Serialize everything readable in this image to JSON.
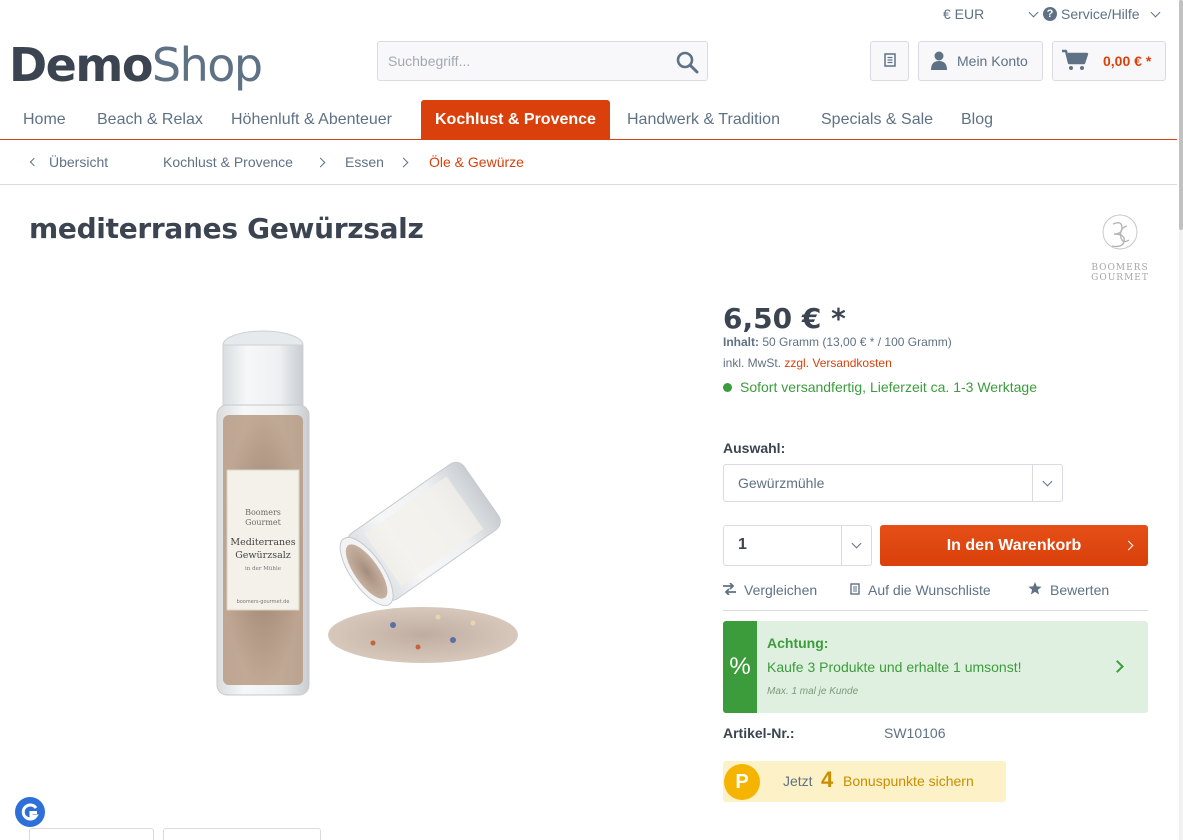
{
  "topbar": {
    "currency": "€ EUR",
    "service": "Service/Hilfe"
  },
  "logo": {
    "bold": "Demo",
    "light": "Shop"
  },
  "search": {
    "placeholder": "Suchbegriff..."
  },
  "header": {
    "account": "Mein Konto",
    "cart_total": "0,00 € *"
  },
  "nav": [
    {
      "label": "Home"
    },
    {
      "label": "Beach & Relax"
    },
    {
      "label": "Höhenluft & Abenteuer"
    },
    {
      "label": "Kochlust & Provence"
    },
    {
      "label": "Handwerk & Tradition"
    },
    {
      "label": "Specials & Sale"
    },
    {
      "label": "Blog"
    }
  ],
  "breadcrumb": {
    "back": "Übersicht",
    "items": [
      "Kochlust & Provence",
      "Essen",
      "Öle & Gewürze"
    ]
  },
  "product": {
    "title": "mediterranes Gewürzsalz",
    "brand_line1": "Boomers",
    "brand_line2": "Gourmet",
    "price": "6,50 € *",
    "content_label": "Inhalt:",
    "content_value": "50 Gramm (13,00 € * / 100 Gramm)",
    "tax_text": "inkl. MwSt.",
    "shipping_link": "zzgl. Versandkosten",
    "stock": "Sofort versandfertig, Lieferzeit ca. 1-3 Werktage",
    "variant_label": "Auswahl:",
    "variant_value": "Gewürzmühle",
    "quantity": "1",
    "cart_button": "In den Warenkorb",
    "compare": "Vergleichen",
    "wishlist": "Auf die Wunschliste",
    "rate": "Bewerten",
    "promo_title": "Achtung:",
    "promo_text": "Kaufe 3 Produkte und erhalte 1 umsonst!",
    "promo_note": "Max. 1 mal je Kunde",
    "sku_label": "Artikel-Nr.:",
    "sku_value": "SW10106",
    "bonus_prefix": "Jetzt",
    "bonus_points": "4",
    "bonus_suffix": "Bonuspunkte sichern",
    "bonus_coin": "P",
    "promo_symbol": "%"
  },
  "image_label": {
    "line1": "Mediterranes",
    "line2": "Gewürzsalz",
    "line3": "in der Mühle",
    "brand1": "Boomers",
    "brand2": "Gourmet",
    "url": "boomers-gourmet.de"
  },
  "colors": {
    "accent": "#d9400b",
    "success": "#3c9c3c",
    "text": "#5f7285"
  }
}
